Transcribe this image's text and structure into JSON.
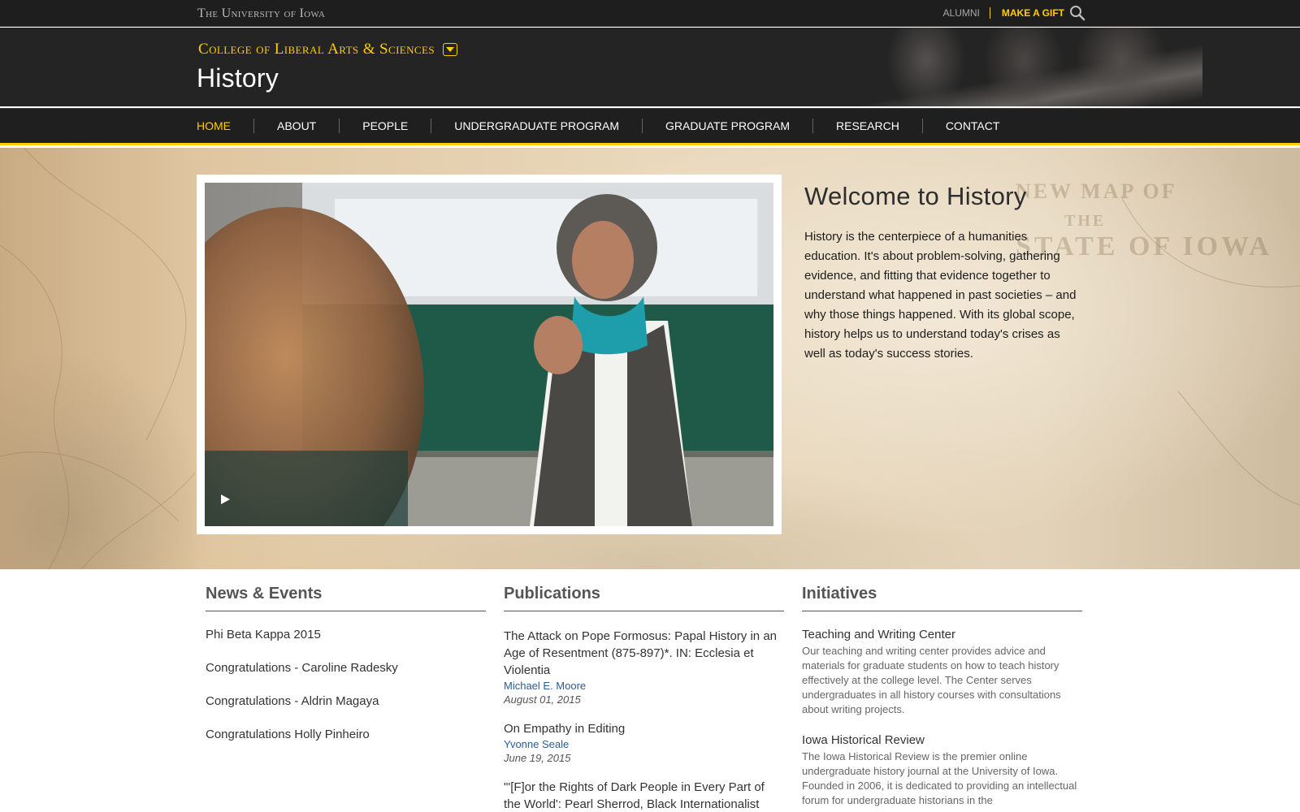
{
  "topbar": {
    "university": "The University of Iowa",
    "alumni": "ALUMNI",
    "gift": "MAKE A GIFT",
    "search_icon": "search-icon"
  },
  "header": {
    "college": "College of Liberal Arts & Sciences",
    "toggle_icon": "chevron-down-icon",
    "department": "History"
  },
  "nav": {
    "items": [
      "HOME",
      "ABOUT",
      "PEOPLE",
      "UNDERGRADUATE PROGRAM",
      "GRADUATE PROGRAM",
      "RESEARCH",
      "CONTACT"
    ],
    "active_index": 0
  },
  "hero": {
    "play_icon": "play-icon",
    "welcome_title": "Welcome to History",
    "welcome_text": "History is the centerpiece of a humanities education. It's about problem-solving, gathering evidence, and fitting that evidence together to understand what happened in past societies – and why those things happened. With its global scope, history helps us to understand today's crises as well as today's success stories."
  },
  "news": {
    "heading": "News & Events",
    "items": [
      "Phi Beta Kappa 2015",
      "Congratulations - Caroline Radesky",
      "Congratulations - Aldrin Magaya",
      "Congratulations Holly Pinheiro"
    ]
  },
  "publications": {
    "heading": "Publications",
    "items": [
      {
        "title": "The Attack on Pope Formosus: Papal History in an Age of Resentment (875-897)*. IN: Ecclesia et Violentia",
        "author": "Michael E. Moore",
        "date": "August 01, 2015"
      },
      {
        "title": "On Empathy in Editing",
        "author": "Yvonne Seale",
        "date": "June 19, 2015"
      },
      {
        "title": "\"'[F]or the Rights of Dark People in Every Part of the World': Pearl Sherrod, Black Internationalist",
        "author": "",
        "date": ""
      }
    ]
  },
  "initiatives": {
    "heading": "Initiatives",
    "items": [
      {
        "title": "Teaching and Writing Center",
        "description": "Our teaching and writing center provides advice and materials for graduate students on how to teach history effectively at the college level. The Center serves undergraduates in all history courses with consultations about writing projects."
      },
      {
        "title": "Iowa Historical Review",
        "description": "The Iowa Historical Review is the premier online undergraduate history journal at the University of Iowa. Founded in 2006, it is dedicated to providing an intellectual forum for undergraduate historians in the"
      }
    ]
  },
  "colors": {
    "brand_gold": "#ffcd00",
    "dark": "#1f1f1f",
    "link_blue": "#2a5d8f"
  }
}
